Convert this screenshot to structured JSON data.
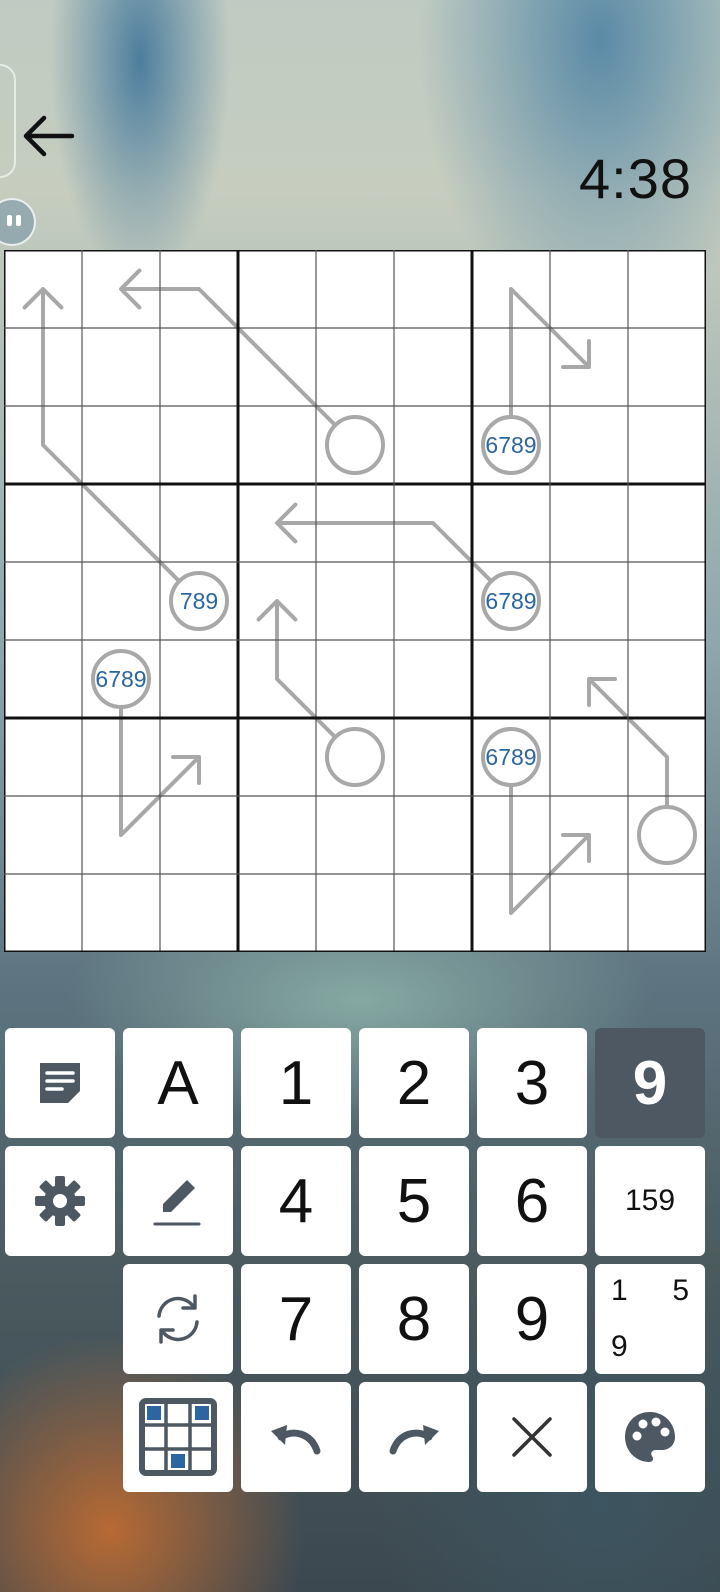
{
  "header": {
    "back_icon": "arrow-left-icon",
    "pause_icon": "pause-icon",
    "timer": "4:38"
  },
  "board": {
    "size": 9,
    "circle_labels": [
      {
        "row": 2,
        "col": 4,
        "text": ""
      },
      {
        "row": 2,
        "col": 6,
        "text": "6789"
      },
      {
        "row": 4,
        "col": 2,
        "text": "789"
      },
      {
        "row": 4,
        "col": 6,
        "text": "6789"
      },
      {
        "row": 5,
        "col": 1,
        "text": "6789"
      },
      {
        "row": 6,
        "col": 4,
        "text": ""
      },
      {
        "row": 6,
        "col": 6,
        "text": "6789"
      },
      {
        "row": 7,
        "col": 8,
        "text": ""
      }
    ],
    "arrows": [
      {
        "from": [
          2,
          4
        ],
        "path": [
          [
            0,
            2
          ],
          [
            0,
            1
          ]
        ]
      },
      {
        "from": [
          2,
          6
        ],
        "path": [
          [
            0,
            6
          ],
          [
            1,
            7
          ]
        ]
      },
      {
        "from": [
          4,
          2
        ],
        "path": [
          [
            2,
            0
          ],
          [
            0,
            0
          ]
        ]
      },
      {
        "from": [
          4,
          6
        ],
        "path": [
          [
            3,
            5
          ],
          [
            3,
            3
          ]
        ]
      },
      {
        "from": [
          5,
          1
        ],
        "path": [
          [
            7,
            1
          ],
          [
            6,
            2
          ]
        ]
      },
      {
        "from": [
          6,
          4
        ],
        "path": [
          [
            5,
            3
          ],
          [
            4,
            3
          ]
        ]
      },
      {
        "from": [
          6,
          6
        ],
        "path": [
          [
            8,
            6
          ],
          [
            7,
            7
          ]
        ]
      },
      {
        "from": [
          7,
          8
        ],
        "path": [
          [
            6,
            8
          ],
          [
            5,
            7
          ]
        ]
      }
    ]
  },
  "keypad": {
    "notes_icon": "note-icon",
    "mode_label": "A",
    "digits": [
      "1",
      "2",
      "3",
      "4",
      "5",
      "6",
      "7",
      "8",
      "9"
    ],
    "selected_digit": "9",
    "settings_icon": "gear-icon",
    "pencil_icon": "pencil-icon",
    "center_note_label": "159",
    "refresh_icon": "refresh-icon",
    "corner_note": {
      "tl": "1",
      "tr": "5",
      "bl": "9"
    },
    "highlight_icon": "grid-highlight-icon",
    "undo_icon": "undo-icon",
    "redo_icon": "redo-icon",
    "clear_icon": "close-icon",
    "palette_icon": "palette-icon"
  },
  "colors": {
    "key_active_bg": "#4e5862",
    "candidate_text": "#2b66a0",
    "arrow_gray": "#a8a8a8",
    "icon_slate": "#4e5862"
  }
}
